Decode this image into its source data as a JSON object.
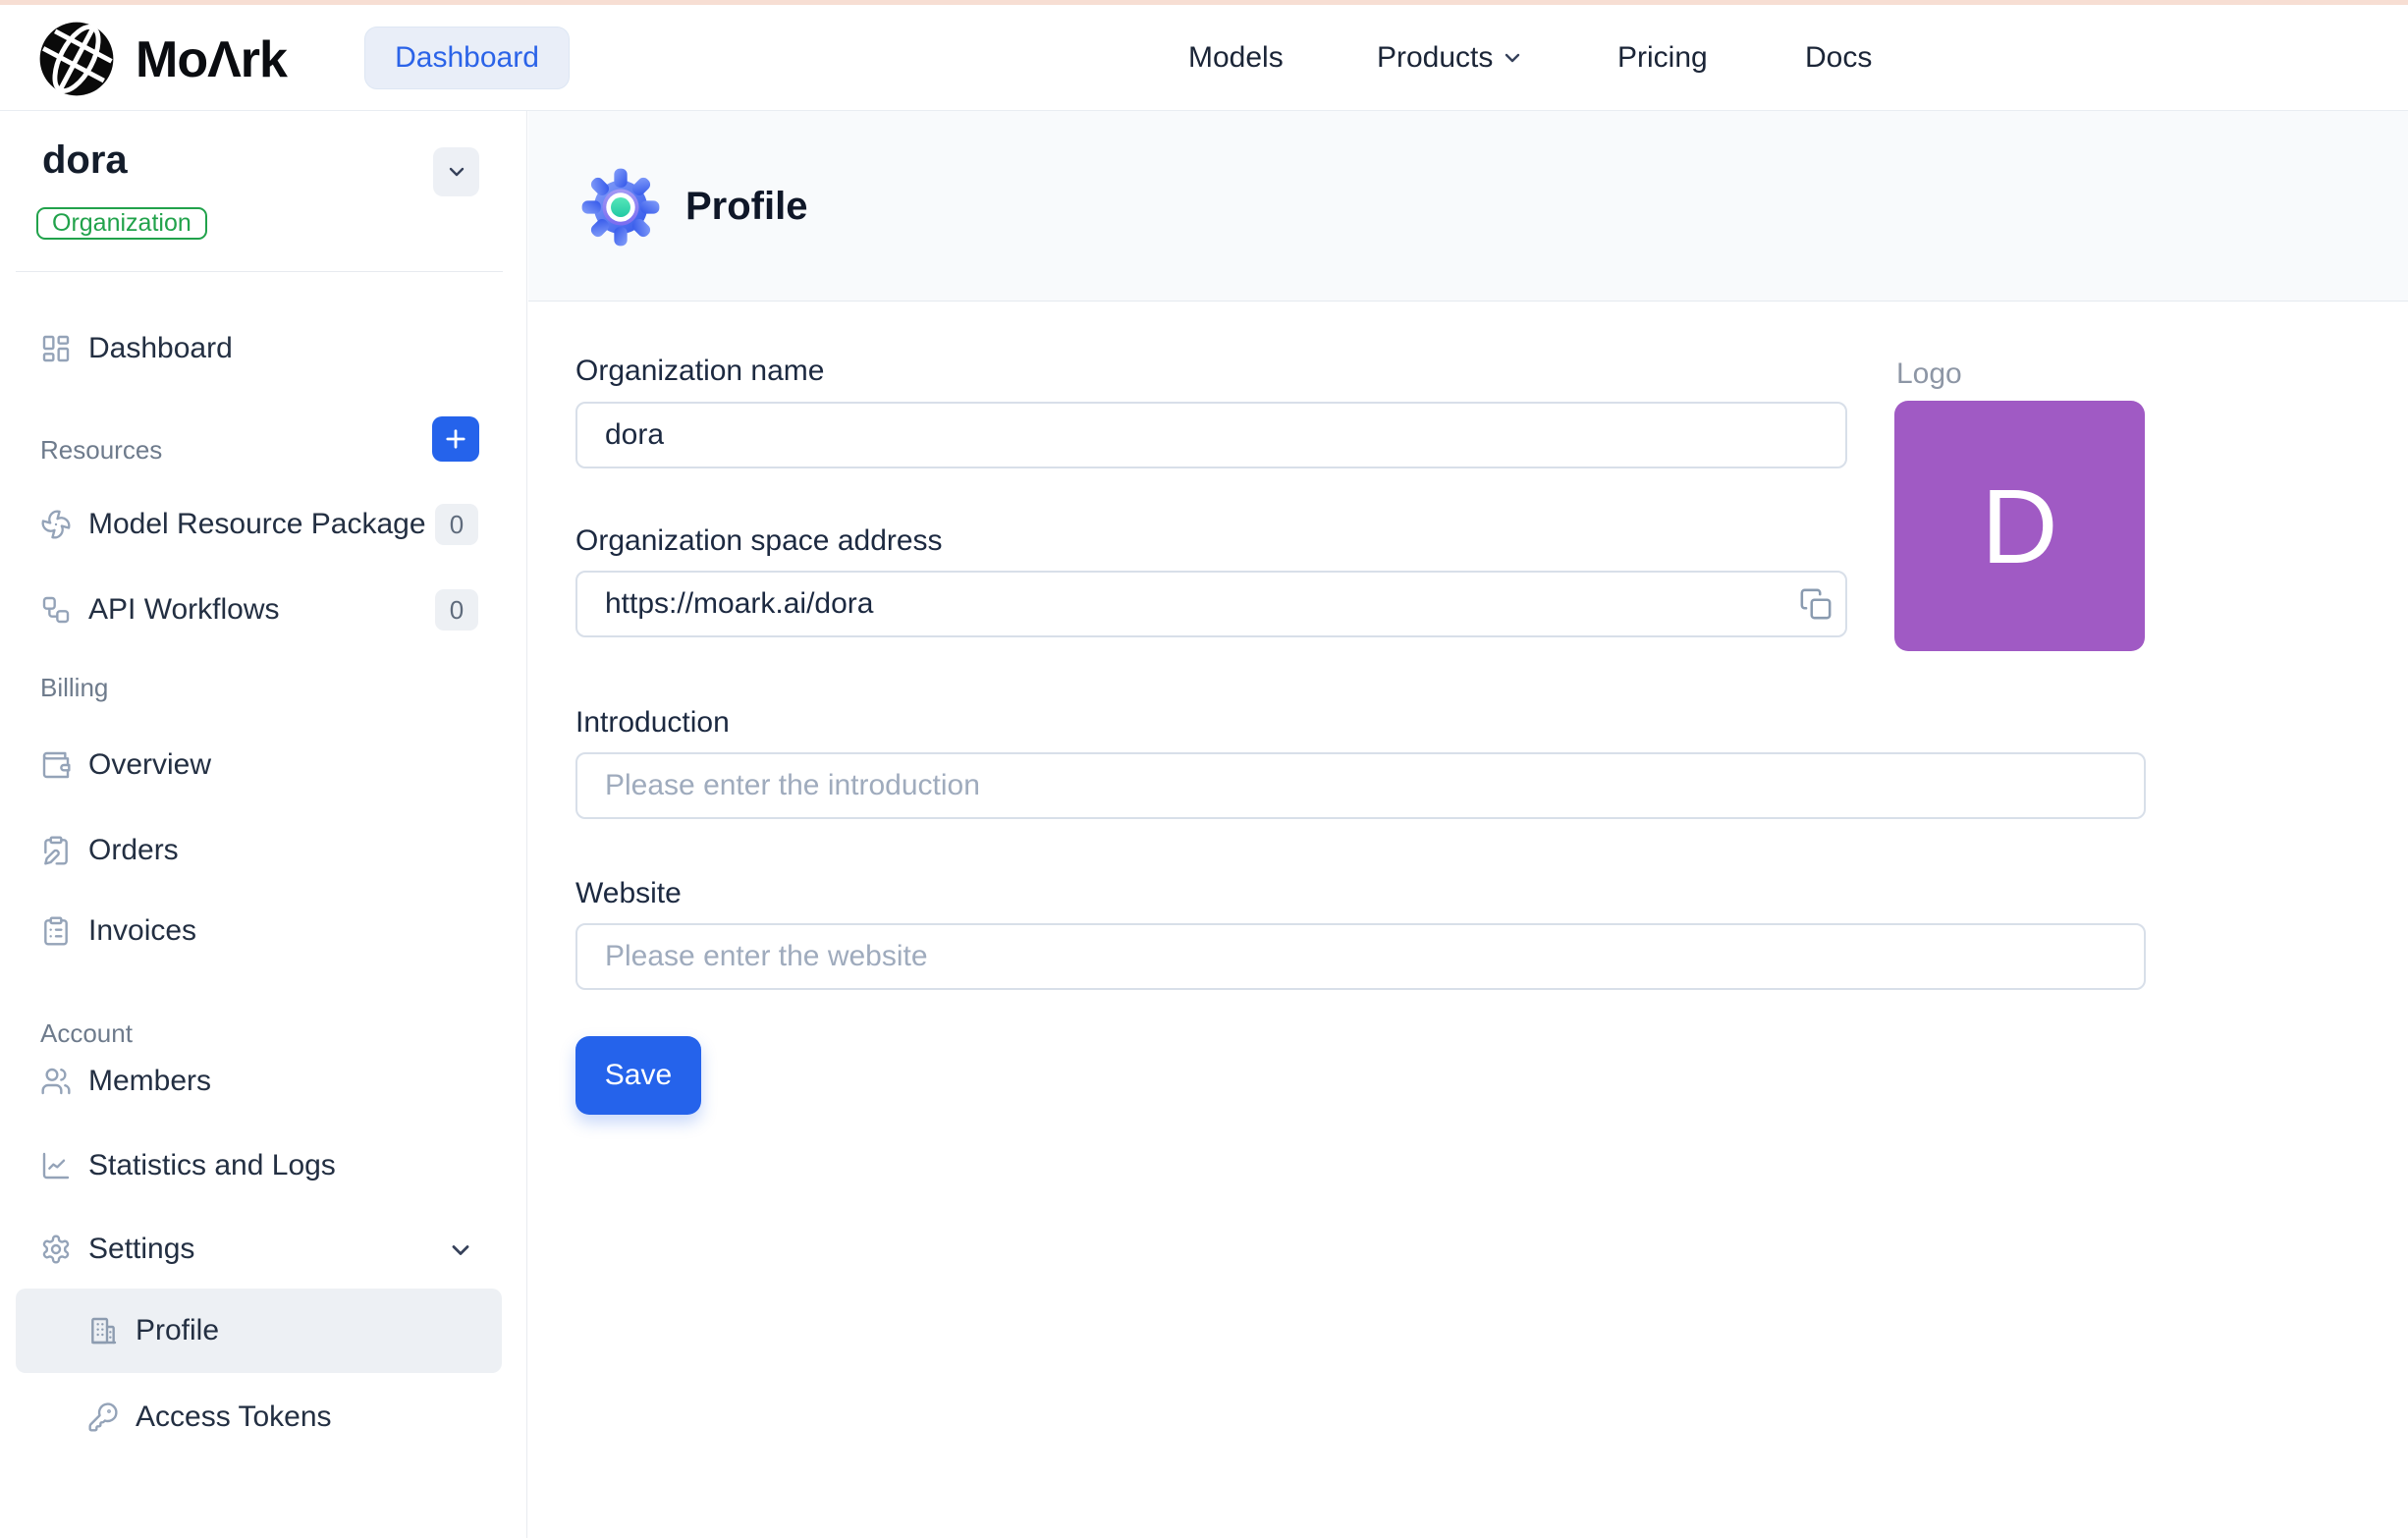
{
  "colors": {
    "accent_blue": "#2563eb",
    "badge_green": "#21a24b",
    "logo_purple": "#a05ac4",
    "top_accent_peach": "#f7ded3"
  },
  "header": {
    "brand": "MoΛrk",
    "dashboard_button": "Dashboard",
    "nav": [
      {
        "label": "Models"
      },
      {
        "label": "Products",
        "has_dropdown": true
      },
      {
        "label": "Pricing"
      },
      {
        "label": "Docs"
      }
    ]
  },
  "sidebar": {
    "org": {
      "name": "dora",
      "badge": "Organization"
    },
    "dashboard_item": "Dashboard",
    "resources": {
      "label": "Resources",
      "items": [
        {
          "label": "Model Resource Package",
          "count": "0"
        },
        {
          "label": "API Workflows",
          "count": "0"
        }
      ]
    },
    "billing": {
      "label": "Billing",
      "items": [
        {
          "label": "Overview"
        },
        {
          "label": "Orders"
        },
        {
          "label": "Invoices"
        }
      ]
    },
    "account": {
      "label": "Account",
      "members": "Members",
      "stats": "Statistics and Logs",
      "settings": "Settings",
      "profile": "Profile",
      "access_tokens": "Access Tokens"
    }
  },
  "main": {
    "title": "Profile",
    "form": {
      "org_name": {
        "label": "Organization name",
        "value": "dora"
      },
      "space_address": {
        "label": "Organization space address",
        "value": "https://moark.ai/dora"
      },
      "introduction": {
        "label": "Introduction",
        "placeholder": "Please enter the introduction"
      },
      "website": {
        "label": "Website",
        "placeholder": "Please enter the website"
      },
      "logo": {
        "label": "Logo",
        "initial": "D"
      },
      "save_label": "Save"
    }
  }
}
